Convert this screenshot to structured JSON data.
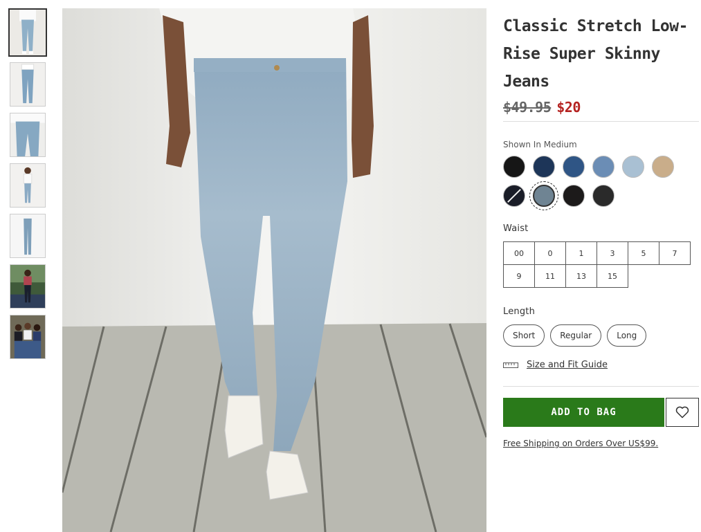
{
  "thumbnails": [
    {
      "name": "thumb-1",
      "selected": true
    },
    {
      "name": "thumb-2"
    },
    {
      "name": "thumb-3"
    },
    {
      "name": "thumb-4"
    },
    {
      "name": "thumb-5"
    },
    {
      "name": "thumb-6"
    },
    {
      "name": "thumb-7"
    }
  ],
  "product": {
    "title": "Classic Stretch Low-Rise Super Skinny Jeans",
    "price_original": "$49.95",
    "price_sale": "$20"
  },
  "colors": {
    "shown_in": "Shown In Medium",
    "swatches": [
      {
        "color": "#161616"
      },
      {
        "color": "#1d3558"
      },
      {
        "color": "#2f5585"
      },
      {
        "color": "#6b8db5"
      },
      {
        "color": "#a9c0d3"
      },
      {
        "color": "#c9ad8a"
      },
      {
        "color": "#1a1d28",
        "slash": true
      },
      {
        "color": "#6f8493",
        "selected": true
      },
      {
        "color": "#1c1a1a"
      },
      {
        "color": "#2a2a2a"
      }
    ]
  },
  "waist": {
    "label": "Waist",
    "sizes": [
      "00",
      "0",
      "1",
      "3",
      "5",
      "7",
      "9",
      "11",
      "13",
      "15"
    ]
  },
  "length": {
    "label": "Length",
    "options": [
      "Short",
      "Regular",
      "Long"
    ]
  },
  "size_guide": "Size and Fit Guide",
  "add_to_bag": "ADD TO BAG",
  "shipping": "Free Shipping on Orders Over US$99.",
  "accent": {
    "sale": "#b52321",
    "cta": "#2a7a1a"
  }
}
